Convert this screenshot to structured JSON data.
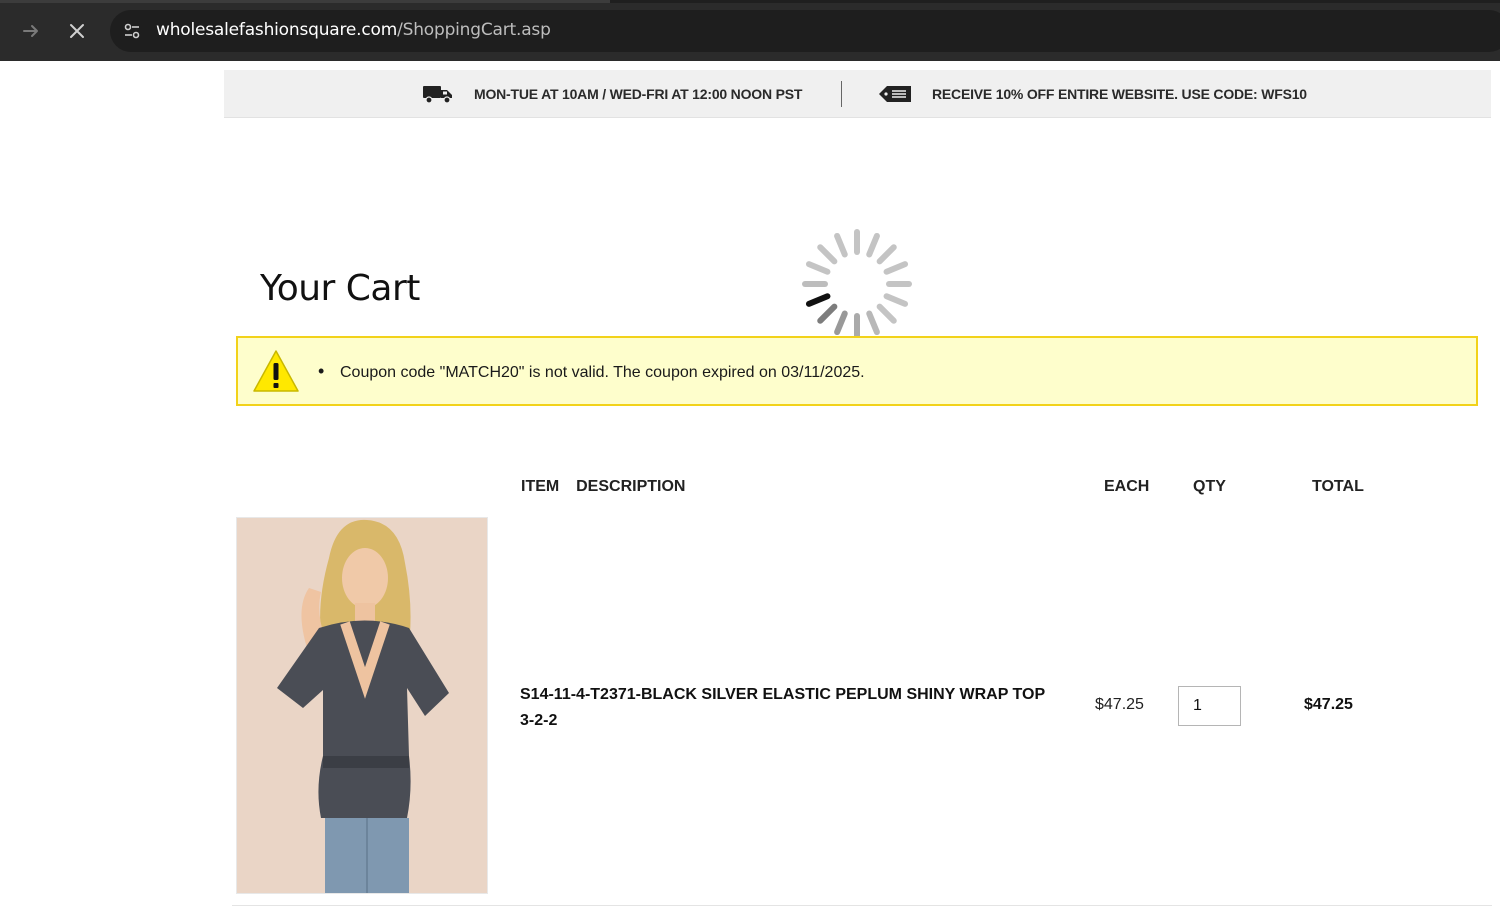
{
  "browser": {
    "url_domain": "wholesalefashionsquare.com",
    "url_path": "/ShoppingCart.asp",
    "forward_icon": "arrow-right-icon",
    "stop_icon": "close-icon",
    "site_info_icon": "tune-icon"
  },
  "promo_bar": {
    "hours_text": "MON-TUE AT 10AM / WED-FRI AT 12:00 NOON PST",
    "hours_icon": "truck-icon",
    "coupon_text": "RECEIVE 10% OFF ENTIRE WEBSITE. USE CODE: WFS10",
    "coupon_icon": "tag-icon"
  },
  "page_title": "Your Cart",
  "loading_icon": "spinner-icon",
  "alert": {
    "icon": "warning-icon",
    "messages": [
      "Coupon code \"MATCH20\" is not valid. The coupon expired on 03/11/2025."
    ],
    "background": "#fefecc",
    "border_color": "#f2d21a"
  },
  "cart": {
    "headers": {
      "description": "ITEM  DESCRIPTION",
      "each": "EACH",
      "qty": "QTY",
      "total": "TOTAL"
    },
    "items": [
      {
        "name": "S14-11-4-T2371-BLACK SILVER ELASTIC PEPLUM SHINY WRAP TOP 3-2-2",
        "each": "$47.25",
        "qty": "1",
        "total": "$47.25",
        "image_alt": "product-photo"
      }
    ]
  }
}
